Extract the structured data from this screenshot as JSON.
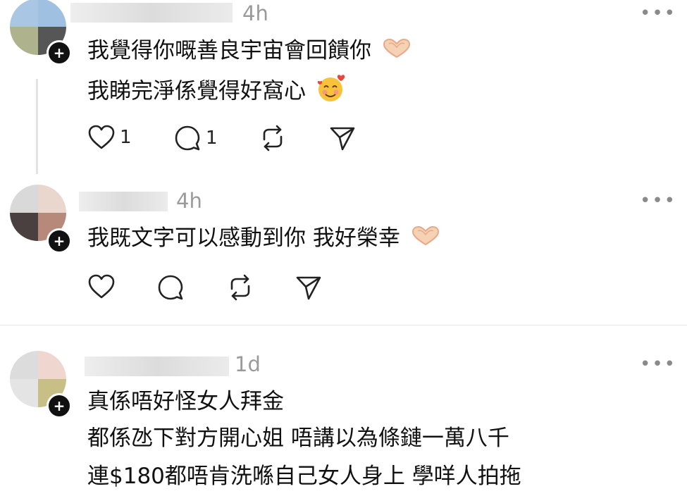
{
  "posts": [
    {
      "time": "4h",
      "more": "•••",
      "lines": [
        "我覺得你嘅善良宇宙會回饋你",
        "我睇完淨係覺得好窩心"
      ],
      "like_count": "1",
      "reply_count": "1",
      "emojis": [
        "heart-hands",
        "smiling-face-with-hearts"
      ]
    },
    {
      "time": "4h",
      "more": "•••",
      "lines": [
        "我既文字可以感動到你 我好榮幸"
      ],
      "emojis": [
        "heart-hands"
      ]
    },
    {
      "time": "1d",
      "more": "•••",
      "lines": [
        "真係唔好怪女人拜金",
        "都係氹下對方開心姐 唔講以為條鏈一萬八千",
        "連$180都唔肯洗喺自己女人身上 學咩人拍拖"
      ]
    }
  ],
  "icons": [
    "heart-icon",
    "comment-icon",
    "repost-icon",
    "share-icon",
    "more-icon",
    "follow-plus-icon"
  ],
  "colors": {
    "text": "#111111",
    "muted": "#9a9a9a",
    "divider": "#e6e6e6",
    "heart_hands": "#f3c3a0"
  }
}
